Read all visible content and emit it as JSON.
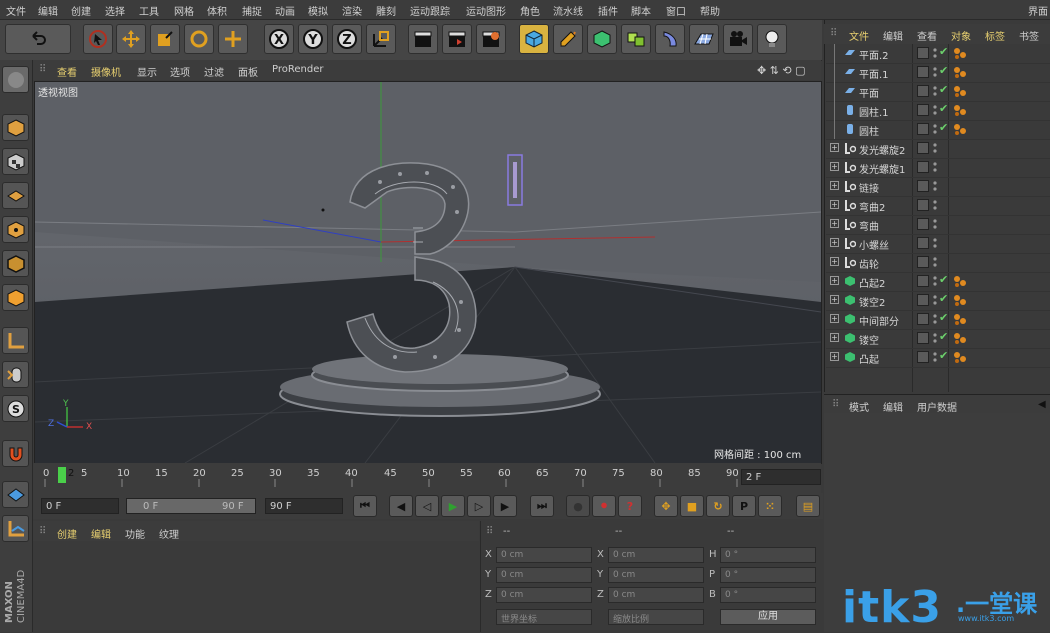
{
  "menu": {
    "items": [
      "文件",
      "编辑",
      "创建",
      "选择",
      "工具",
      "网格",
      "体积",
      "捕捉",
      "动画",
      "模拟",
      "渲染",
      "雕刻",
      "运动跟踪",
      "运动图形",
      "角色",
      "流水线",
      "插件",
      "脚本",
      "窗口",
      "帮助"
    ],
    "right": "界面"
  },
  "viewport": {
    "tabs": [
      "查看",
      "摄像机",
      "显示",
      "选项",
      "过滤",
      "面板",
      "ProRender"
    ],
    "label": "透视视图",
    "grid_spacing": "网格间距 : 100 cm",
    "axis_y": "Y",
    "axis_z": "Z",
    "axis_x": "X"
  },
  "timeline": {
    "ticks": [
      "0",
      "2",
      "5",
      "10",
      "15",
      "20",
      "25",
      "30",
      "35",
      "40",
      "45",
      "50",
      "55",
      "60",
      "65",
      "70",
      "75",
      "80",
      "85",
      "90"
    ],
    "current_frame": "2 F",
    "start": "0 F",
    "min": "0 F",
    "max": "90 F",
    "end": "90 F"
  },
  "material_panel": {
    "tabs": [
      "创建",
      "编辑",
      "功能",
      "纹理"
    ]
  },
  "coord_panel": {
    "header_cols": [
      "--",
      "--",
      "--"
    ],
    "rows": [
      {
        "a_label": "X",
        "a_val": "0 cm",
        "b_label": "X",
        "b_val": "0 cm",
        "c_label": "H",
        "c_val": "0 °"
      },
      {
        "a_label": "Y",
        "a_val": "0 cm",
        "b_label": "Y",
        "b_val": "0 cm",
        "c_label": "P",
        "c_val": "0 °"
      },
      {
        "a_label": "Z",
        "a_val": "0 cm",
        "b_label": "Z",
        "b_val": "0 cm",
        "c_label": "B",
        "c_val": "0 °"
      }
    ],
    "world_coords": "世界坐标",
    "scale_mode": "缩放比例",
    "apply": "应用"
  },
  "object_manager": {
    "tabs": [
      "文件",
      "编辑",
      "查看",
      "对象",
      "标签",
      "书签"
    ],
    "objects": [
      {
        "name": "平面.2",
        "icon": "plane-icon",
        "expand": false,
        "checked": true,
        "tag": true
      },
      {
        "name": "平面.1",
        "icon": "plane-icon",
        "expand": false,
        "checked": true,
        "tag": true
      },
      {
        "name": "平面",
        "icon": "plane-icon",
        "expand": false,
        "checked": true,
        "tag": true
      },
      {
        "name": "圆柱.1",
        "icon": "cylinder-icon",
        "expand": false,
        "checked": true,
        "tag": true
      },
      {
        "name": "圆柱",
        "icon": "cylinder-icon",
        "expand": false,
        "checked": true,
        "tag": true
      },
      {
        "name": "发光螺旋2",
        "icon": "null-icon",
        "expand": true,
        "checked": false,
        "tag": false
      },
      {
        "name": "发光螺旋1",
        "icon": "null-icon",
        "expand": true,
        "checked": false,
        "tag": false
      },
      {
        "name": "链接",
        "icon": "null-icon",
        "expand": true,
        "checked": false,
        "tag": false
      },
      {
        "name": "弯曲2",
        "icon": "null-icon",
        "expand": true,
        "checked": false,
        "tag": false
      },
      {
        "name": "弯曲",
        "icon": "null-icon",
        "expand": true,
        "checked": false,
        "tag": false
      },
      {
        "name": "小螺丝",
        "icon": "null-icon",
        "expand": true,
        "checked": false,
        "tag": false
      },
      {
        "name": "齿轮",
        "icon": "null-icon",
        "expand": true,
        "checked": false,
        "tag": false
      },
      {
        "name": "凸起2",
        "icon": "extrude-icon",
        "expand": true,
        "checked": true,
        "tag": true
      },
      {
        "name": "镂空2",
        "icon": "extrude-icon",
        "expand": true,
        "checked": true,
        "tag": true
      },
      {
        "name": "中间部分",
        "icon": "extrude-icon",
        "expand": true,
        "checked": true,
        "tag": true
      },
      {
        "name": "镂空",
        "icon": "extrude-icon",
        "expand": true,
        "checked": true,
        "tag": true
      },
      {
        "name": "凸起",
        "icon": "extrude-icon",
        "expand": true,
        "checked": true,
        "tag": true
      }
    ]
  },
  "attribute_manager": {
    "tabs": [
      "模式",
      "编辑",
      "用户数据"
    ]
  },
  "branding": {
    "maxon_line1": "MAXON",
    "maxon_line2": "CINEMA4D"
  },
  "watermark": {
    "main": "itk3",
    "cn": ".一堂课",
    "sub": "www.itk3.com"
  },
  "colors": {
    "accent_yellow": "#d9b340",
    "check_green": "#6cd06c",
    "watermark_blue": "#3aa0e8"
  }
}
